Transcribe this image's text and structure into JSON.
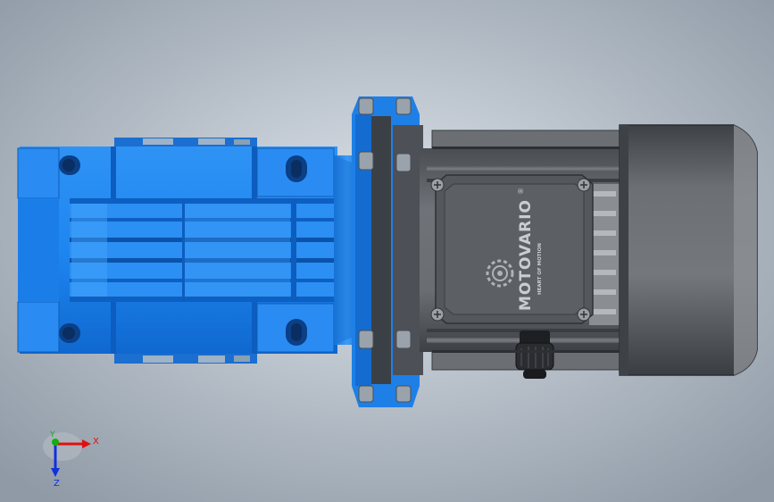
{
  "viewport": {
    "background": {
      "center": "#dde3ea",
      "edge": "#8f9aa6"
    }
  },
  "model": {
    "brand_text": "MOTOVARIO",
    "registered_mark": "®",
    "tagline_text": "HEART OF MOTION",
    "colors": {
      "gearbox": "#1e86f0",
      "gearbox_dark": "#0a5fc6",
      "gearbox_light": "#4aa8ff",
      "motor_body": "#5d6167",
      "motor_dark": "#33363b",
      "terminal_box": "#4f5358",
      "fan_cover": "#6a6e73"
    }
  },
  "triad": {
    "x_label": "X",
    "y_label": "Y",
    "z_label": "Z",
    "x_color": "#e01010",
    "y_color": "#10b010",
    "z_color": "#1030e0"
  }
}
